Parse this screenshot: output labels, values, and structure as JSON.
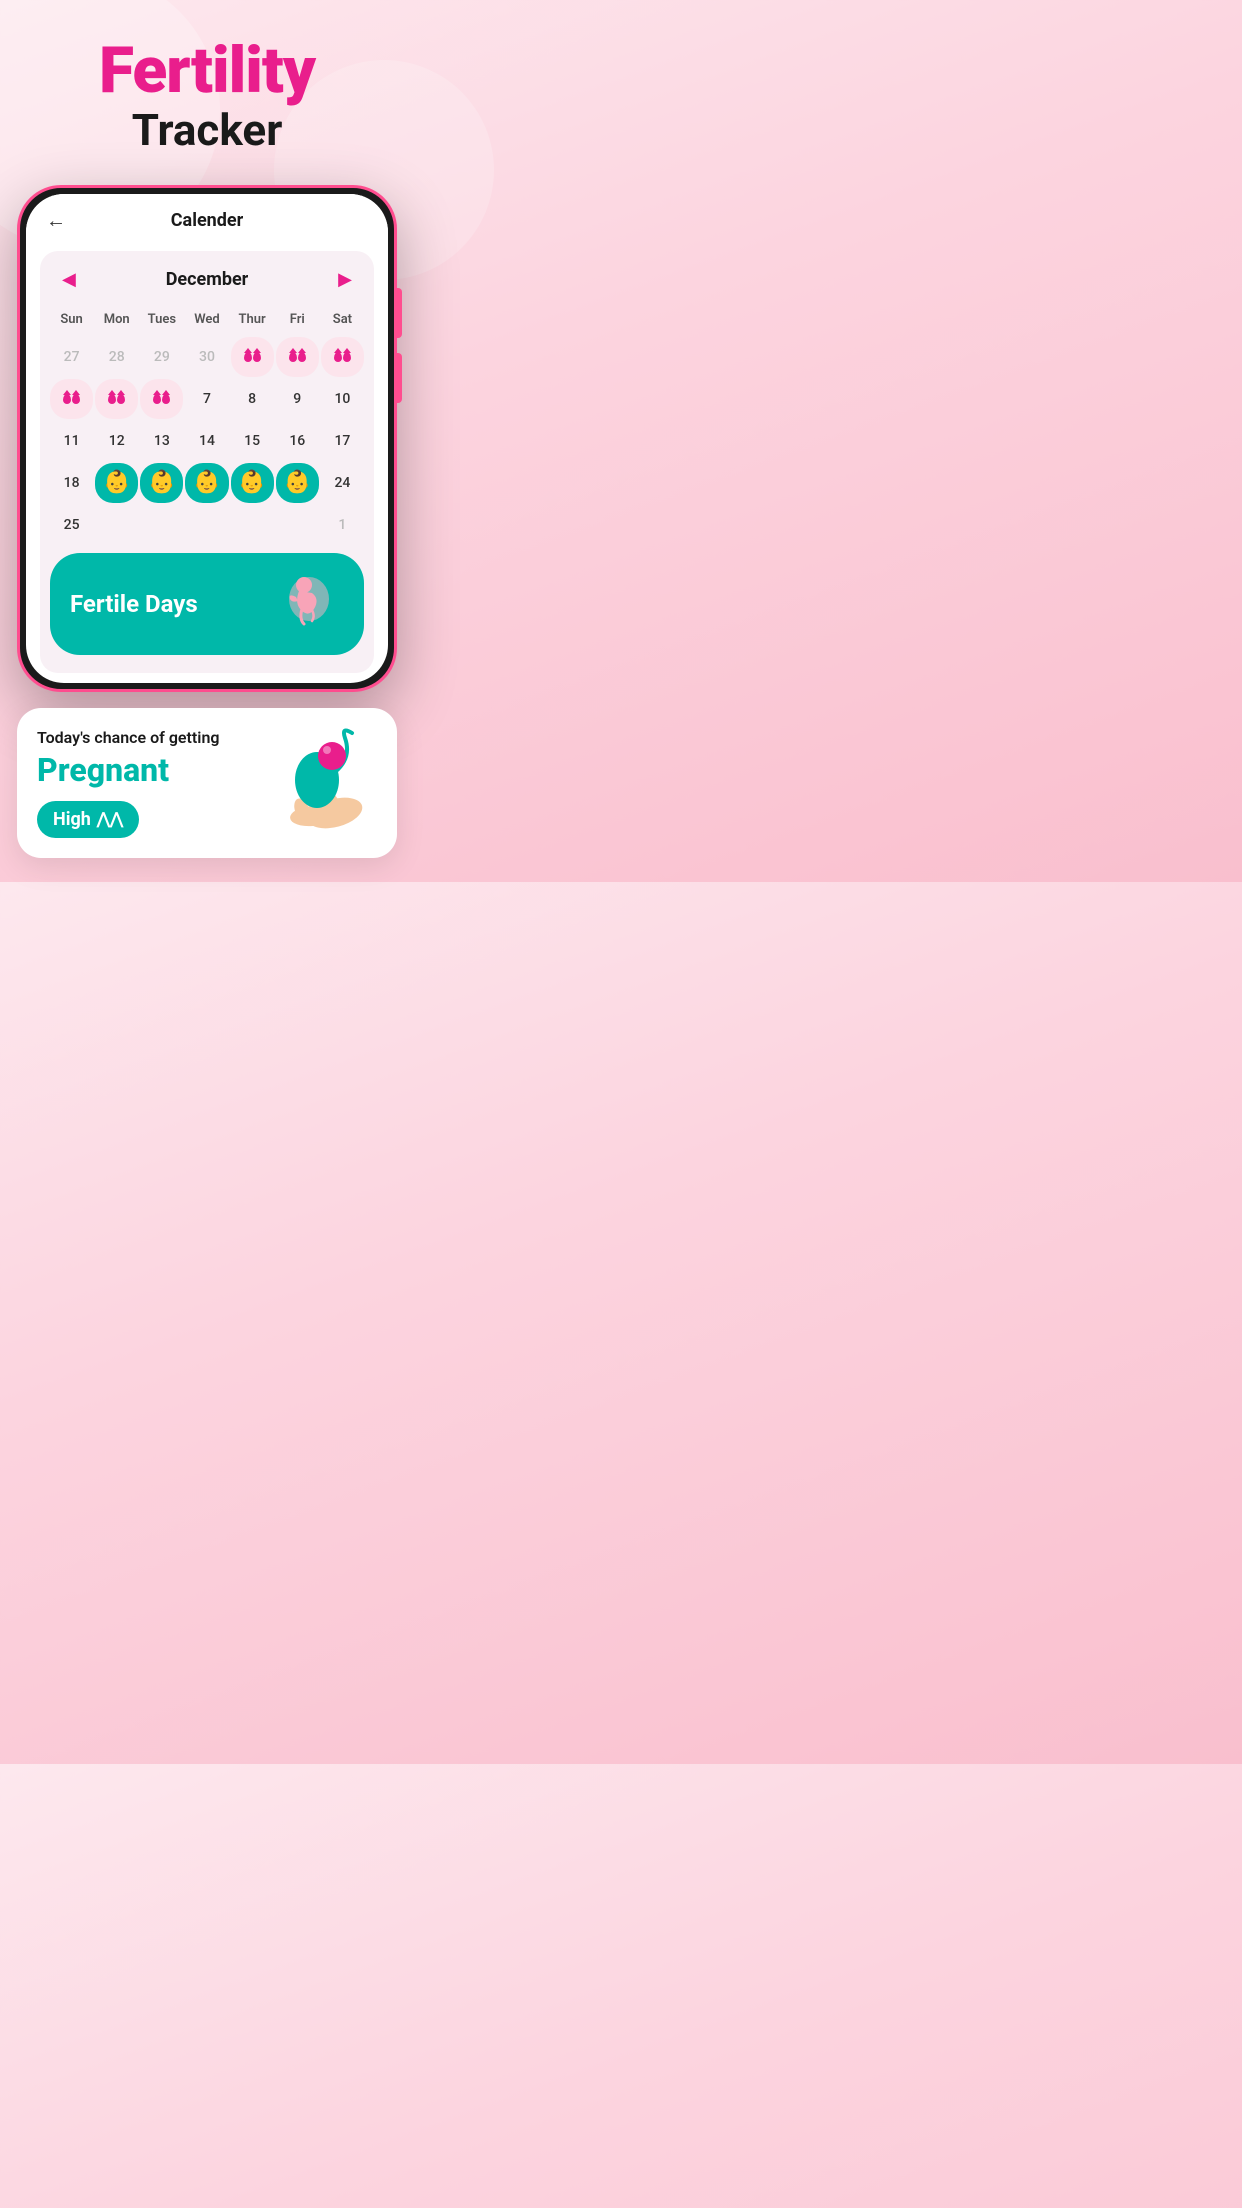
{
  "header": {
    "title_fertility": "Fertility",
    "title_tracker": "Tracker"
  },
  "phone": {
    "topbar_title": "Calender",
    "back_arrow": "←"
  },
  "calendar": {
    "month": "December",
    "prev_arrow": "◀",
    "next_arrow": "▶",
    "day_headers": [
      "Sun",
      "Mon",
      "Tues",
      "Wed",
      "Thur",
      "Fri",
      "Sat"
    ],
    "weeks": [
      {
        "days": [
          "27",
          "28",
          "29",
          "30",
          "",
          "",
          ""
        ],
        "types": [
          "outside",
          "outside",
          "outside",
          "outside",
          "period",
          "period",
          "period"
        ]
      },
      {
        "days": [
          "",
          "",
          "",
          "7",
          "8",
          "9",
          "10"
        ],
        "types": [
          "period",
          "period",
          "period",
          "normal",
          "normal",
          "normal",
          "normal"
        ]
      },
      {
        "days": [
          "11",
          "12",
          "13",
          "14",
          "15",
          "16",
          "17"
        ],
        "types": [
          "normal",
          "normal",
          "normal",
          "normal",
          "normal",
          "normal",
          "normal"
        ]
      },
      {
        "days": [
          "18",
          "",
          "",
          "",
          "",
          "",
          "24"
        ],
        "types": [
          "normal",
          "fertile",
          "fertile",
          "fertile",
          "fertile",
          "fertile",
          "normal"
        ]
      },
      {
        "days": [
          "25",
          "",
          "",
          "",
          "",
          "",
          "1"
        ],
        "types": [
          "normal",
          "normal",
          "normal",
          "normal",
          "normal",
          "normal",
          "outside"
        ]
      }
    ],
    "fertile_banner": "Fertile Days"
  },
  "info_card": {
    "subtitle": "Today's chance of getting",
    "title": "Pregnant",
    "badge_label": "High",
    "badge_icon": "chevron-up"
  }
}
